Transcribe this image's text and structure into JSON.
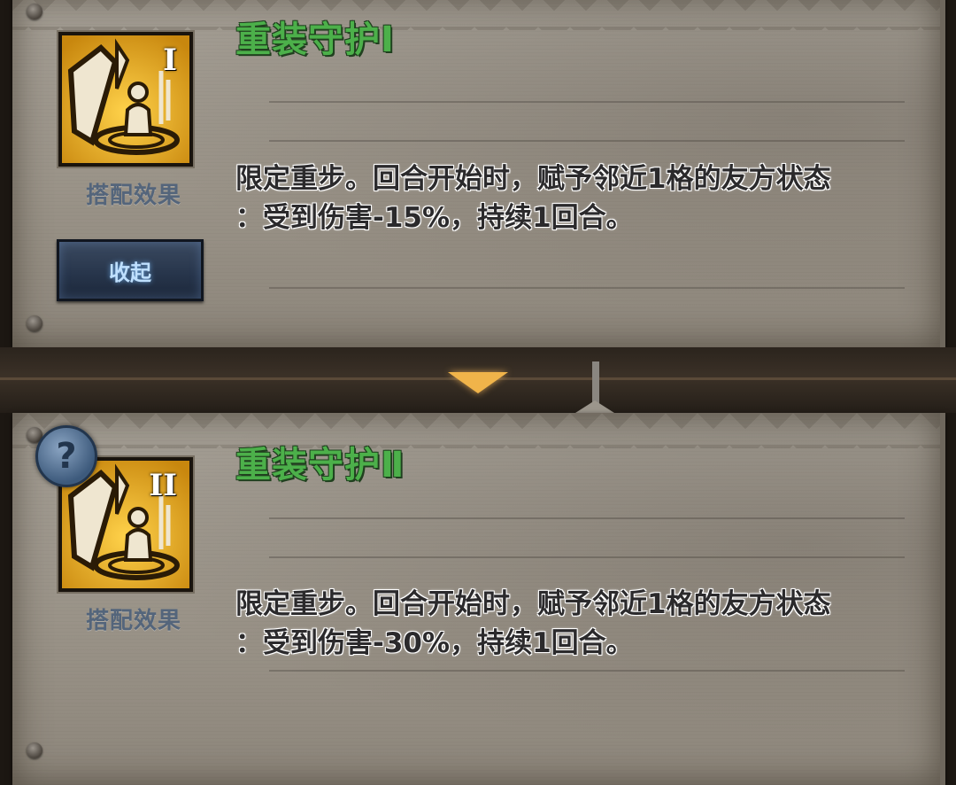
{
  "skills": [
    {
      "title": "重装守护Ⅰ",
      "roman": "I",
      "combo_label": "搭配效果",
      "desc_line1": "限定重步。回合开始时，赋予邻近1格的友方状态",
      "desc_line2": "：受到伤害-15%，持续1回合。"
    },
    {
      "title": "重装守护Ⅱ",
      "roman": "II",
      "combo_label": "搭配效果",
      "desc_line1": "限定重步。回合开始时，赋予邻近1格的友方状态",
      "desc_line2": "：受到伤害-30%，持续1回合。"
    }
  ],
  "collapse_button": "收起",
  "help_glyph": "?",
  "icons": {
    "skill": "guard-shield-icon",
    "expand": "chevron-down-icon",
    "help": "question-icon"
  },
  "colors": {
    "title_green": "#4cb04a",
    "icon_gold": "#e0a81c",
    "arrow": "#f0b44a"
  }
}
